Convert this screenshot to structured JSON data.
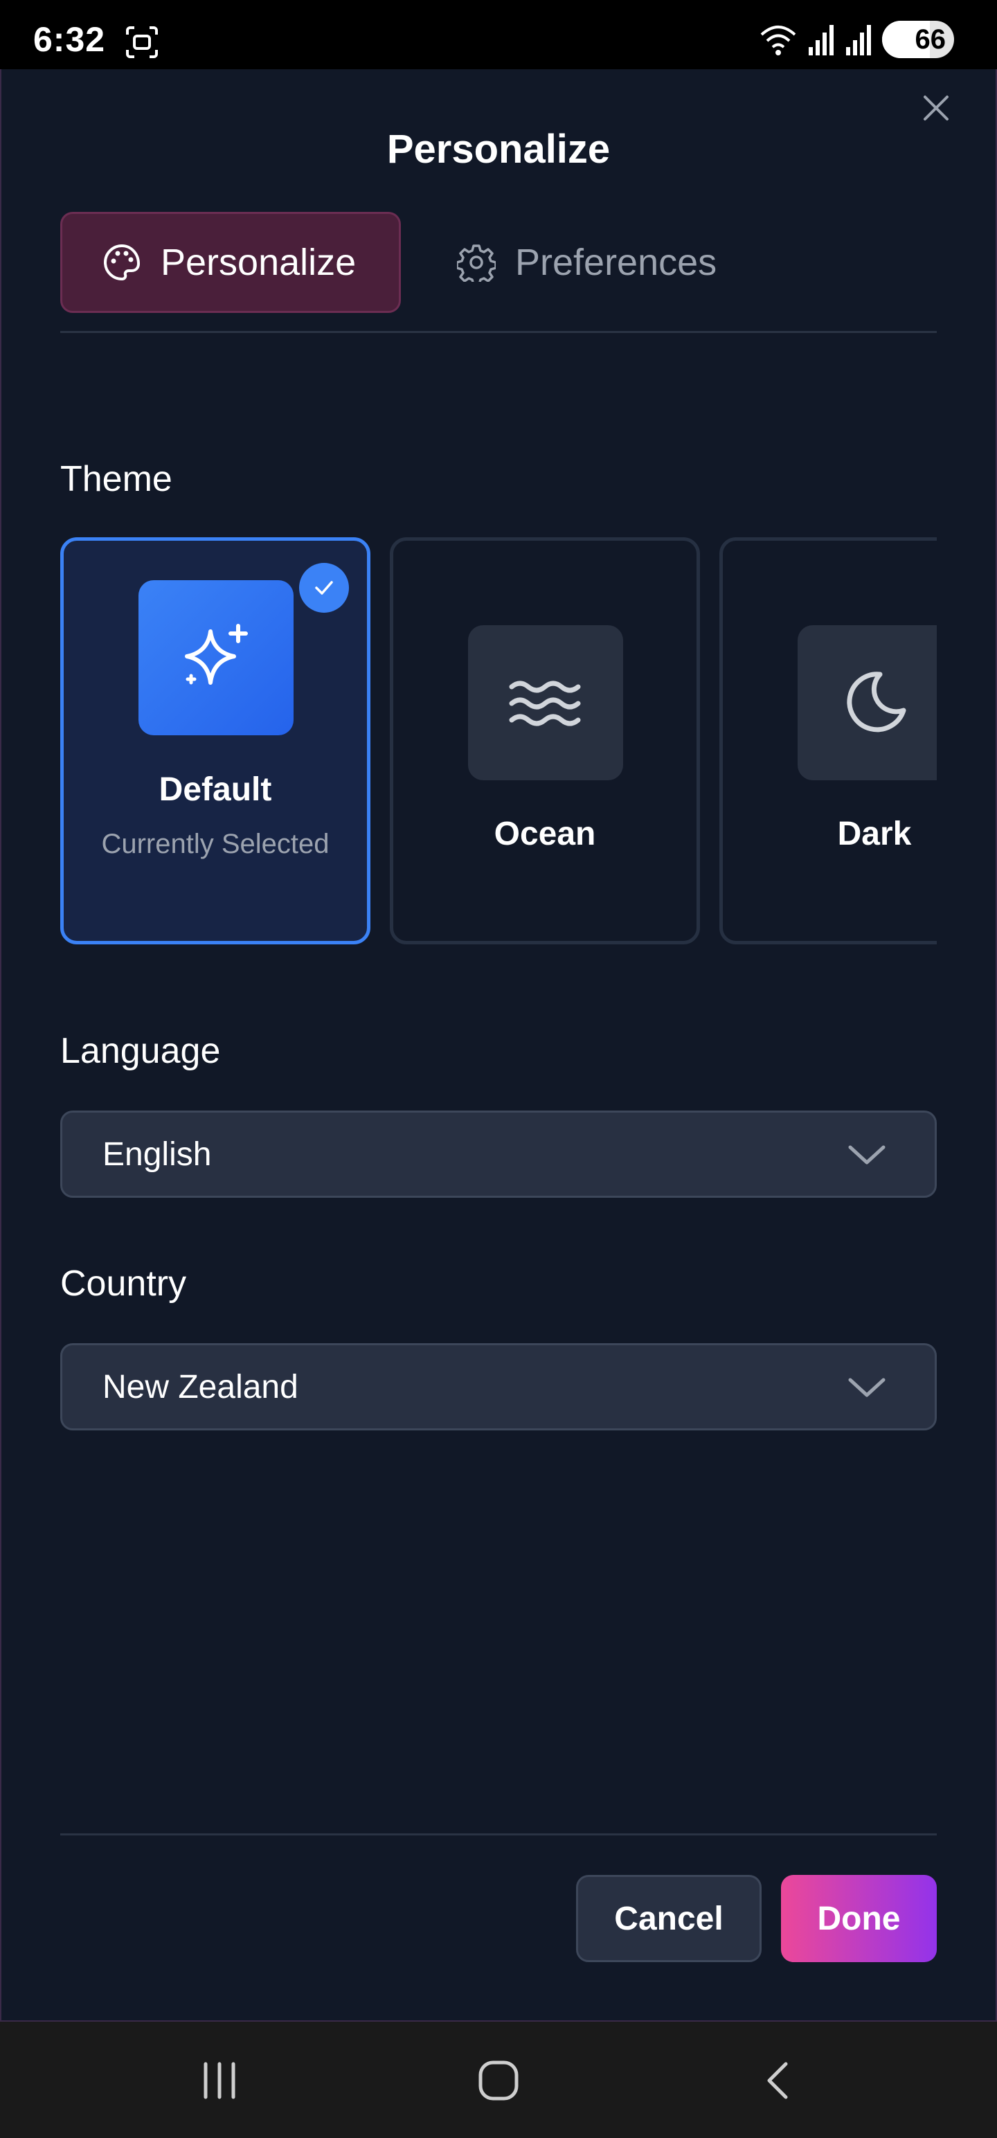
{
  "status_bar": {
    "time": "6:32",
    "battery": "66",
    "battery_level": 0.66
  },
  "dialog": {
    "title": "Personalize",
    "tabs": [
      {
        "label": "Personalize",
        "icon": "palette-icon",
        "active": true
      },
      {
        "label": "Preferences",
        "icon": "gear-icon",
        "active": false
      }
    ],
    "theme": {
      "label": "Theme",
      "options": [
        {
          "name": "Default",
          "subtitle": "Currently Selected",
          "icon": "sparkles-icon",
          "selected": true
        },
        {
          "name": "Ocean",
          "icon": "waves-icon",
          "selected": false
        },
        {
          "name": "Dark",
          "icon": "moon-icon",
          "selected": false
        }
      ]
    },
    "language": {
      "label": "Language",
      "value": "English"
    },
    "country": {
      "label": "Country",
      "value": "New Zealand"
    },
    "buttons": {
      "cancel": "Cancel",
      "done": "Done"
    }
  },
  "colors": {
    "background": "#111827",
    "accent_blue": "#3b82f6",
    "accent_pink": "#ec4899",
    "accent_purple": "#9333ea"
  }
}
